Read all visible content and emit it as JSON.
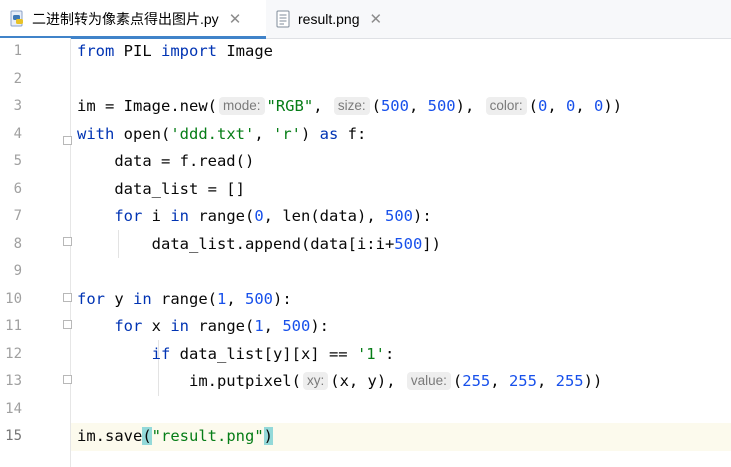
{
  "tabs": [
    {
      "label": "二进制转为像素点得出图片.py",
      "icon": "python-file-icon",
      "active": true
    },
    {
      "label": "result.png",
      "icon": "image-file-icon",
      "active": false
    }
  ],
  "line_numbers": [
    "1",
    "2",
    "3",
    "4",
    "5",
    "6",
    "7",
    "8",
    "9",
    "10",
    "11",
    "12",
    "13",
    "14",
    "15"
  ],
  "code": {
    "l1": {
      "kw1": "from",
      "t1": " PIL ",
      "kw2": "import",
      "t2": " Image"
    },
    "l3": {
      "t1": "im = Image.new(",
      "h1": "mode:",
      "s1": "\"RGB\"",
      "t2": ", ",
      "h2": "size:",
      "t3": "(",
      "n1": "500",
      "t4": ", ",
      "n2": "500",
      "t5": "), ",
      "h3": "color:",
      "t6": "(",
      "n3": "0",
      "t7": ", ",
      "n4": "0",
      "t8": ", ",
      "n5": "0",
      "t9": "))"
    },
    "l4": {
      "kw1": "with",
      "t1": " open(",
      "s1": "'ddd.txt'",
      "t2": ", ",
      "s2": "'r'",
      "t3": ") ",
      "kw2": "as",
      "t4": " f:"
    },
    "l5": {
      "t1": "    data = f.read()"
    },
    "l6": {
      "t1": "    data_list = []"
    },
    "l7": {
      "t0": "    ",
      "kw1": "for",
      "t1": " i ",
      "kw2": "in",
      "t2": " range(",
      "n1": "0",
      "t3": ", len(data), ",
      "n2": "500",
      "t4": "):"
    },
    "l8": {
      "t1": "        data_list.append(data[i:i+",
      "n1": "500",
      "t2": "])"
    },
    "l10": {
      "kw1": "for",
      "t1": " y ",
      "kw2": "in",
      "t2": " range(",
      "n1": "1",
      "t3": ", ",
      "n2": "500",
      "t4": "):"
    },
    "l11": {
      "t0": "    ",
      "kw1": "for",
      "t1": " x ",
      "kw2": "in",
      "t2": " range(",
      "n1": "1",
      "t3": ", ",
      "n2": "500",
      "t4": "):"
    },
    "l12": {
      "t0": "        ",
      "kw1": "if",
      "t1": " data_list[y][x] == ",
      "s1": "'1'",
      "t2": ":"
    },
    "l13": {
      "t1": "            im.putpixel(",
      "h1": "xy:",
      "t2": "(x, y), ",
      "h2": "value:",
      "t3": "(",
      "n1": "255",
      "t4": ", ",
      "n2": "255",
      "t5": ", ",
      "n3": "255",
      "t6": "))"
    },
    "l15": {
      "t1": "im.save",
      "b1": "(",
      "s1": "\"result.png\"",
      "b2": ")"
    }
  }
}
